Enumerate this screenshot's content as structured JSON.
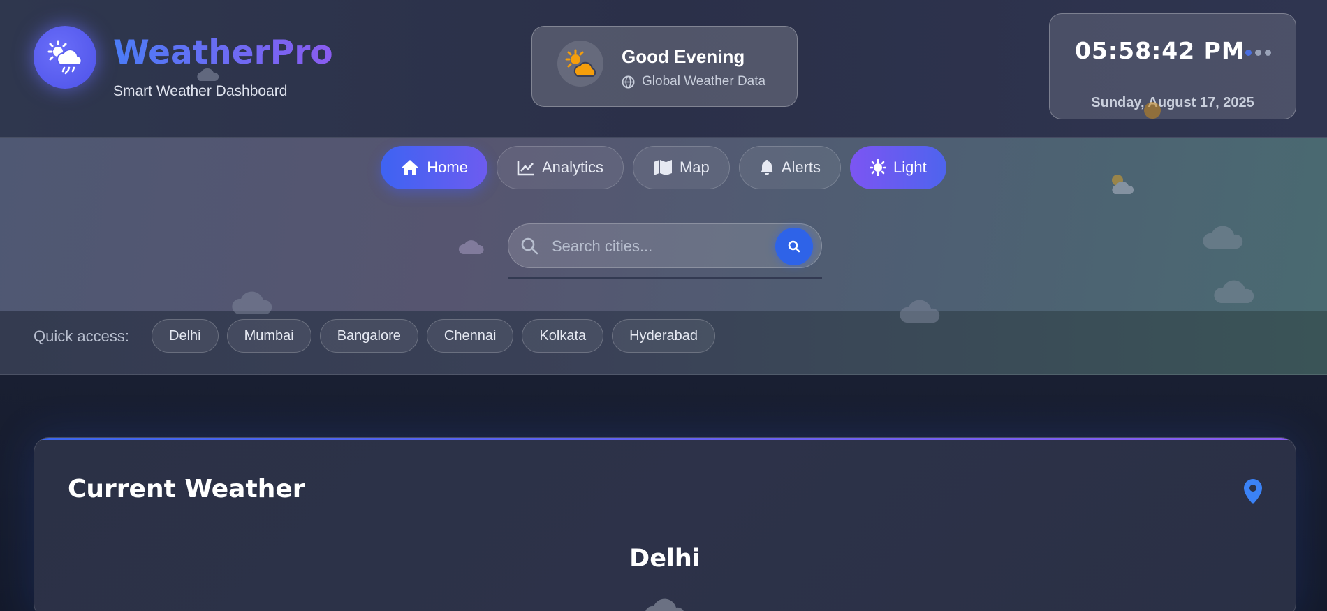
{
  "brand": {
    "title": "WeatherPro",
    "subtitle": "Smart Weather Dashboard"
  },
  "greeting": {
    "title": "Good Evening",
    "subtitle": "Global Weather Data"
  },
  "clock": {
    "time": "05:58:42 PM",
    "date": "Sunday, August 17, 2025"
  },
  "nav": {
    "items": [
      {
        "label": "Home",
        "icon": "home-icon",
        "active": true
      },
      {
        "label": "Analytics",
        "icon": "chart-line-icon"
      },
      {
        "label": "Map",
        "icon": "map-icon"
      },
      {
        "label": "Alerts",
        "icon": "bell-icon"
      },
      {
        "label": "Light",
        "icon": "sun-icon"
      }
    ]
  },
  "search": {
    "placeholder": "Search cities...",
    "value": ""
  },
  "quick_access": {
    "label": "Quick access:",
    "cities": [
      "Delhi",
      "Mumbai",
      "Bangalore",
      "Chennai",
      "Kolkata",
      "Hyderabad"
    ]
  },
  "current_weather": {
    "title": "Current Weather",
    "city": "Delhi"
  },
  "colors": {
    "accent_blue": "#3e63f2",
    "accent_purple": "#7c55f2",
    "sun_orange": "#f59e0b"
  }
}
